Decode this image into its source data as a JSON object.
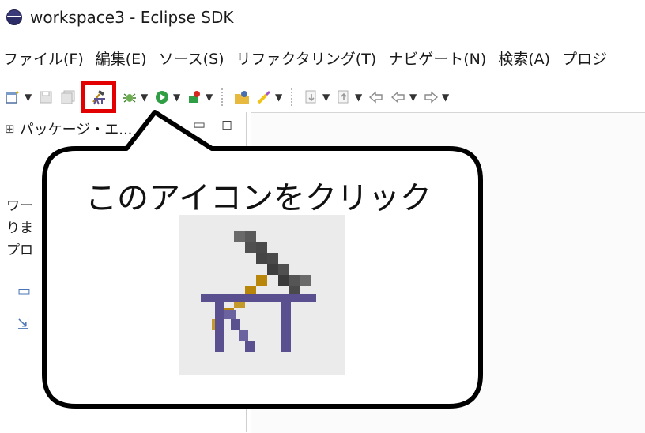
{
  "window": {
    "title": "workspace3 - Eclipse SDK",
    "icon": "eclipse-icon"
  },
  "menubar": {
    "items": [
      "ファイル(F)",
      "編集(E)",
      "ソース(S)",
      "リファクタリング(T)",
      "ナビゲート(N)",
      "検索(A)",
      "プロジ"
    ]
  },
  "toolbar": {
    "icons": [
      "new-wizard-icon",
      "save-icon",
      "save-all-icon",
      "ant-build-icon",
      "debug-icon",
      "run-icon",
      "external-tools-icon",
      "open-type-icon",
      "search-icon",
      "next-annotation-icon",
      "prev-annotation-icon",
      "back-icon",
      "forward-icon"
    ],
    "highlight_color": "#e20000"
  },
  "left_panel": {
    "tab_label": "パッケージ・エ...",
    "welcome_lines": [
      "ワー",
      "りま",
      "プロ"
    ]
  },
  "callout": {
    "text": "このアイコンをクリック",
    "icon": "ant-build-icon"
  }
}
